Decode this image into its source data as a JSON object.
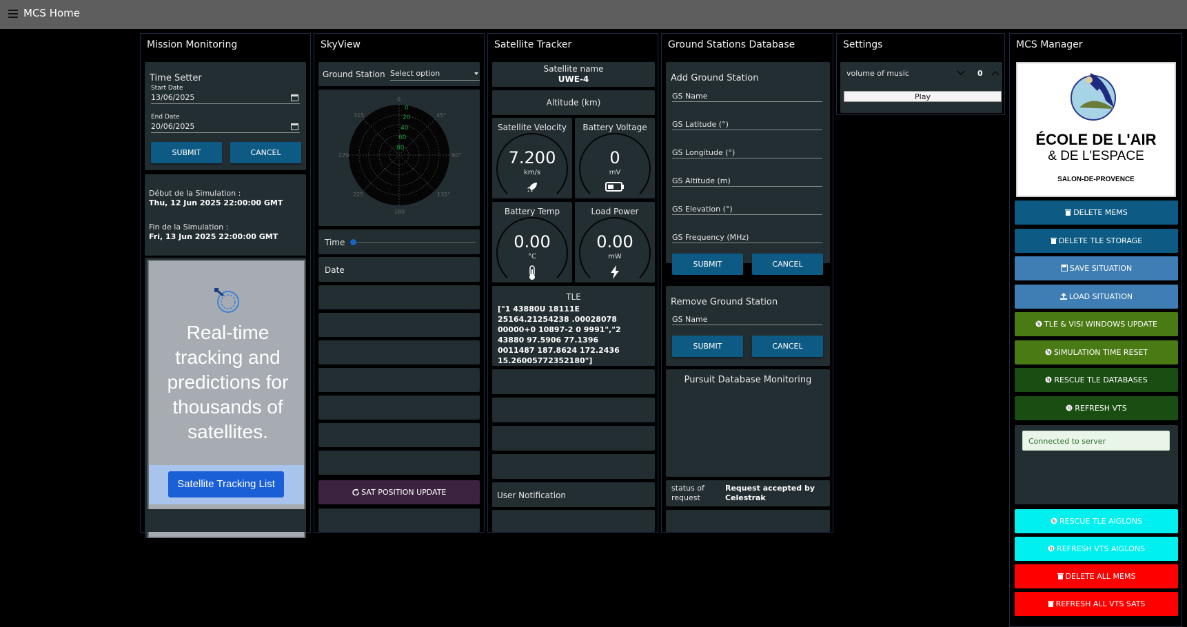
{
  "appbar": {
    "title": "MCS Home"
  },
  "mission": {
    "title": "Mission Monitoring",
    "time_setter": "Time Setter",
    "start_label": "Start Date",
    "start_value": "13/06/2025",
    "end_label": "End Date",
    "end_value": "20/06/2025",
    "submit": "SUBMIT",
    "cancel": "CANCEL",
    "sim_start_label": "Début de la Simulation :",
    "sim_start_value": "Thu, 12 Jun 2025 22:00:00 GMT",
    "sim_end_label": "Fin de la Simulation :",
    "sim_end_value": "Fri, 13 Jun 2025 22:00:00 GMT",
    "promo_text": "Real-time tracking and predictions for thousands of satellites.",
    "tracking_button": "Satellite Tracking List"
  },
  "skyview": {
    "title": "SkyView",
    "gs_label": "Ground Station",
    "gs_select": "Select option",
    "radar_ticks": [
      "0",
      "45°",
      "90°",
      "135°",
      "180",
      "225",
      "270",
      "315"
    ],
    "radar_rings": [
      "0",
      "20",
      "40",
      "60",
      "80"
    ],
    "time_label": "Time",
    "date_label": "Date",
    "update_button": "SAT POSITION UPDATE"
  },
  "tracker": {
    "title": "Satellite Tracker",
    "sat_name_label": "Satellite name",
    "sat_name": "UWE-4",
    "altitude_label": "Altitude (km)",
    "velocity": {
      "title": "Satellite Velocity",
      "value": "7.200",
      "unit": "km/s"
    },
    "voltage": {
      "title": "Battery Voltage",
      "value": "0",
      "unit": "mV"
    },
    "temp": {
      "title": "Battery Temp",
      "value": "0.00",
      "unit": "°C"
    },
    "power": {
      "title": "Load Power",
      "value": "0.00",
      "unit": "mW"
    },
    "tle_label": "TLE",
    "tle_value": "[\"1 43880U 18111E 25164.21254238 .00028078 00000+0 10897-2 0 9991\",\"2 43880 97.5906 77.1396 0011487 187.8624 172.2436 15.26005772352180\"]",
    "user_notification": "User Notification"
  },
  "gsdb": {
    "title": "Ground Stations Database",
    "add_title": "Add Ground Station",
    "fields": [
      "GS Name",
      "GS Latitude (°)",
      "GS Longitude (°)",
      "GS Altitude (m)",
      "GS Elevation (°)",
      "GS Frequency (MHz)"
    ],
    "submit": "SUBMIT",
    "cancel": "CANCEL",
    "remove_title": "Remove Ground Station",
    "remove_field": "GS Name",
    "pursuit_title": "Pursuit Database Monitoring",
    "status_label": "status of request",
    "status_value": "Request accepted by Celestrak"
  },
  "settings": {
    "title": "Settings",
    "volume_label": "volume of music",
    "volume_value": "0",
    "play": "Play"
  },
  "manager": {
    "title": "MCS Manager",
    "logo_line1": "ÉCOLE DE L'AIR",
    "logo_line2": "& DE L'ESPACE",
    "logo_line3": "SALON-DE-PROVENCE",
    "buttons": [
      {
        "label": "DELETE MEMS",
        "icon": "trash-icon",
        "color": "#0d5b84"
      },
      {
        "label": "DELETE TLE STORAGE",
        "icon": "trash-icon",
        "color": "#0d5b84"
      },
      {
        "label": "SAVE SITUATION",
        "icon": "save-icon",
        "color": "#3e7eb5"
      },
      {
        "label": "LOAD SITUATION",
        "icon": "upload-icon",
        "color": "#3e7eb5"
      },
      {
        "label": "TLE & VISI WINDOWS UPDATE",
        "icon": "globe-icon",
        "color": "#4a7a14"
      },
      {
        "label": "SIMULATION TIME RESET",
        "icon": "globe-icon",
        "color": "#4a7a14"
      },
      {
        "label": "RESCUE TLE DATABASES",
        "icon": "globe-icon",
        "color": "#1a4d12"
      },
      {
        "label": "REFRESH VTS",
        "icon": "globe-icon",
        "color": "#1a4d12"
      }
    ],
    "server_status": "Connected to server",
    "buttons2": [
      {
        "label": "RESCUE TLE AIGLONS",
        "icon": "globe-icon",
        "color": "#00f0f0"
      },
      {
        "label": "REFRESH VTS AIGLONS",
        "icon": "globe-icon",
        "color": "#00f0f0"
      },
      {
        "label": "DELETE ALL MEMS",
        "icon": "trash-icon",
        "color": "#ff0000"
      },
      {
        "label": "REFRESH ALL VTS SATS",
        "icon": "trash-icon",
        "color": "#ff0000"
      }
    ]
  }
}
